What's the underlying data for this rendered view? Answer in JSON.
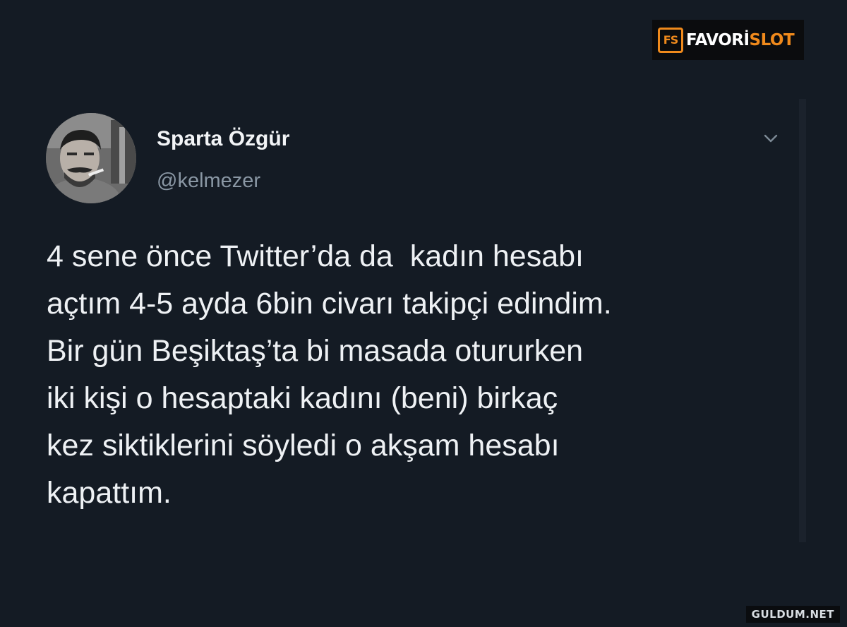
{
  "logo": {
    "mark": "FS",
    "text_white": "FAVORİ",
    "text_orange": "SLOT"
  },
  "tweet": {
    "author_name": "Sparta Özgür",
    "author_handle": "@kelmezer",
    "lines": [
      "4 sene önce Twitter’da da  kadın hesabı",
      "açtım 4-5 ayda 6bin civarı takipçi edindim.",
      "Bir gün Beşiktaş’ta bi masada otururken",
      "iki kişi o hesaptaki kadını (beni) birkaç",
      "kez siktiklerini söyledi o akşam hesabı",
      "kapattım."
    ]
  },
  "icons": {
    "menu": "chevron-down-icon",
    "avatar": "avatar-photo"
  },
  "watermark": "GULDUM.NET",
  "colors": {
    "background": "#141b24",
    "text": "#eef1f4",
    "handle": "#8a97a4",
    "logo_accent": "#f08a1c"
  }
}
